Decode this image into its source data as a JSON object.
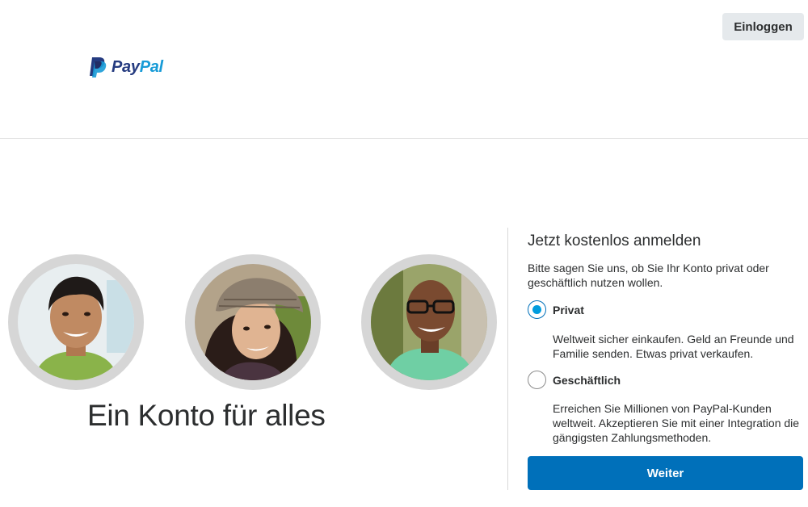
{
  "header": {
    "logo_pay": "Pay",
    "logo_pal": "Pal",
    "login_label": "Einloggen"
  },
  "hero": {
    "tagline": "Ein Konto für alles",
    "avatars": [
      "person-photo-man",
      "person-photo-woman-hat",
      "person-photo-man-glasses"
    ]
  },
  "signup": {
    "title": "Jetzt kostenlos anmelden",
    "description": "Bitte sagen Sie uns, ob Sie Ihr Konto privat oder geschäftlich nutzen wollen.",
    "options": [
      {
        "label": "Privat",
        "selected": true,
        "description": "Weltweit sicher einkaufen. Geld an Freunde und Familie senden. Etwas privat verkaufen."
      },
      {
        "label": "Geschäftlich",
        "selected": false,
        "description": "Erreichen Sie Millionen von PayPal-Kunden weltweit. Akzeptieren Sie mit einer Integration die gängigsten Zahlungsmethoden."
      }
    ],
    "continue_label": "Weiter"
  },
  "colors": {
    "brand_dark": "#253b80",
    "brand_light": "#179bd7",
    "primary_button": "#0070ba",
    "radio_selected": "#009cde"
  }
}
